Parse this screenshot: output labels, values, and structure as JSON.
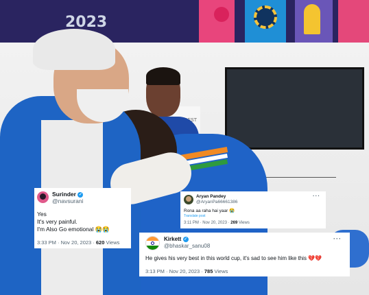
{
  "background": {
    "banner_text": "2023",
    "tv_sign": "HE BEST"
  },
  "tweets": [
    {
      "name": "Surinder",
      "handle": "@navsurani",
      "lines": [
        "Yes",
        "It's very painful.",
        "I'm Also Go emotional 😭😭"
      ],
      "time": "3:33 PM · Nov 20, 2023 · ",
      "views_count": "620",
      "views_label": "Views"
    },
    {
      "name": "Aryan Pandey",
      "handle": "@AryanPa66661386",
      "lines": [
        "Rona aa raha hai yaar 😭"
      ],
      "translate": "Translate post",
      "time": "3:11 PM · Nov 20, 2023 · ",
      "views_count": "269",
      "views_label": "Views"
    },
    {
      "name": "Kirkett",
      "handle": "@bhaskar_sanu08",
      "lines": [
        "He gives his very best in this world cup, it's sad to see him like this 💔💔"
      ],
      "time": "3:13 PM · Nov 20, 2023 · ",
      "views_count": "785",
      "views_label": "Views"
    }
  ],
  "colors": {
    "verified": "#1d9bf0",
    "jersey_blue": "#1f63c7",
    "banner": "#2a2460"
  },
  "icons": [
    "verified-badge-icon",
    "more-options-icon",
    "avatar-image"
  ]
}
